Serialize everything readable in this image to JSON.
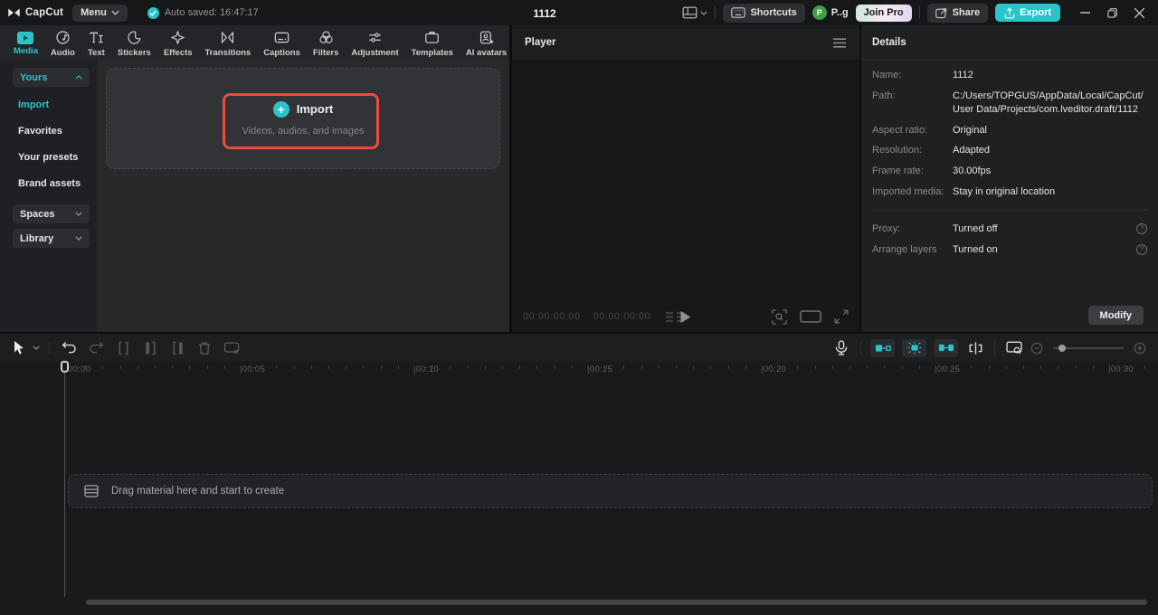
{
  "colors": {
    "accent": "#2bc5c9",
    "annotation_red": "#ee4b3f",
    "avatar_green": "#3f9e46"
  },
  "app": {
    "logo_text": "CapCut",
    "menu_label": "Menu",
    "autosave_text": "Auto saved: 16:47:17",
    "project_title": "1112",
    "shortcuts_label": "Shortcuts",
    "avatar_initial": "P",
    "account_name": "P..g",
    "join_pro_label": "Join Pro",
    "share_label": "Share",
    "export_label": "Export"
  },
  "tabs": [
    {
      "label": "Media"
    },
    {
      "label": "Audio"
    },
    {
      "label": "Text"
    },
    {
      "label": "Stickers"
    },
    {
      "label": "Effects"
    },
    {
      "label": "Transitions"
    },
    {
      "label": "Captions"
    },
    {
      "label": "Filters"
    },
    {
      "label": "Adjustment"
    },
    {
      "label": "Templates"
    },
    {
      "label": "AI avatars"
    }
  ],
  "sidebar": {
    "yours": "Yours",
    "import": "Import",
    "favorites": "Favorites",
    "your_presets": "Your presets",
    "brand_assets": "Brand assets",
    "spaces": "Spaces",
    "library": "Library"
  },
  "media": {
    "import_title": "Import",
    "import_subtitle": "Videos, audios, and images",
    "plus_glyph": "+"
  },
  "player": {
    "title": "Player",
    "timecode_current": "00:00:00:00",
    "timecode_total": "00:00:00:00"
  },
  "details": {
    "title": "Details",
    "rows": [
      {
        "label": "Name:",
        "value": "1112"
      },
      {
        "label": "Path:",
        "value": "C:/Users/TOPGUS/AppData/Local/CapCut/User Data/Projects/com.lveditor.draft/1112"
      },
      {
        "label": "Aspect ratio:",
        "value": "Original"
      },
      {
        "label": "Resolution:",
        "value": "Adapted"
      },
      {
        "label": "Frame rate:",
        "value": "30.00fps"
      },
      {
        "label": "Imported media:",
        "value": "Stay in original location"
      }
    ],
    "toggle_rows": [
      {
        "label": "Proxy:",
        "value": "Turned off"
      },
      {
        "label": "Arrange layers",
        "value": "Turned on"
      }
    ],
    "help_glyph": "?",
    "modify_label": "Modify"
  },
  "timeline": {
    "ruler_labels": [
      "00:00",
      "|00:05",
      "|00:10",
      "|00:15",
      "|00:20",
      "|00:25",
      "|00:30"
    ],
    "drag_hint": "Drag material here and start to create"
  }
}
